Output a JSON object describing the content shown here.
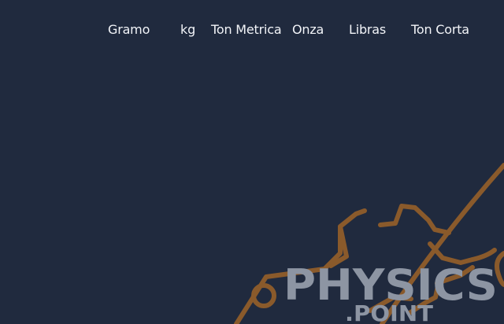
{
  "nav": {
    "units": [
      {
        "label": "Gramo"
      },
      {
        "label": "kg"
      },
      {
        "label": "Ton Metrica"
      },
      {
        "label": "Onza"
      },
      {
        "label": "Libras"
      },
      {
        "label": "Ton Corta"
      }
    ]
  },
  "logo": {
    "line1": "PHYSICS",
    "line2": ".POINT"
  },
  "colors": {
    "background": "#202a3e",
    "accent_orange": "#8a5a2b",
    "logo_gray": "#8d95a3",
    "nav_text": "#f2f4f8"
  }
}
